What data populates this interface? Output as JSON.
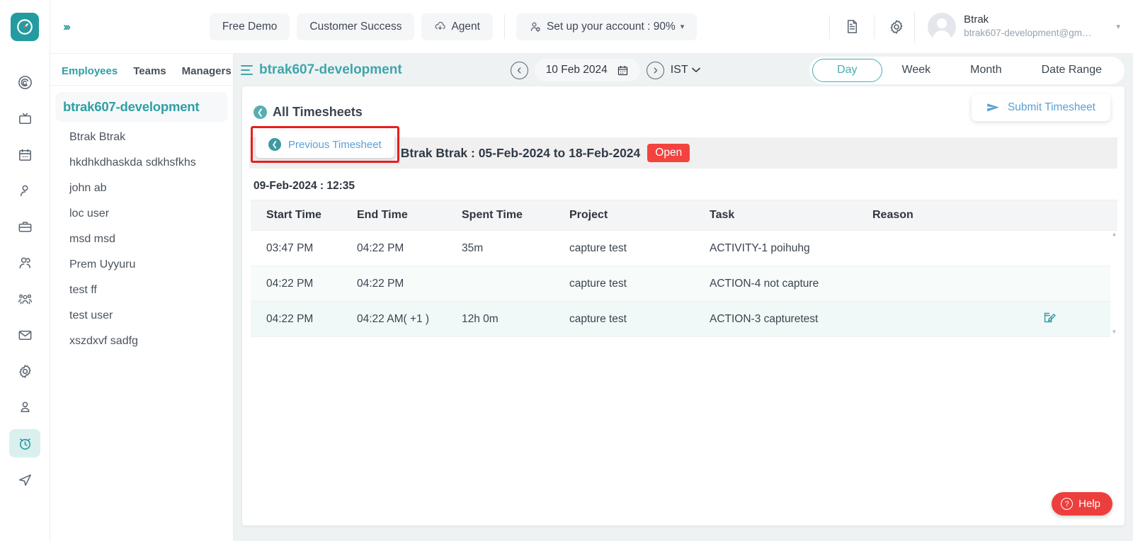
{
  "brand": {
    "accent": "#2fa0a5",
    "danger": "#f3433f",
    "link": "#5d9fd1",
    "highlight": "#e81f1f"
  },
  "topbar": {
    "logo_icon": "clock-logo-icon",
    "expand_icon": "double-chevron-right-icon",
    "buttons": [
      {
        "label": "Free Demo",
        "icon": ""
      },
      {
        "label": "Customer Success",
        "icon": ""
      },
      {
        "label": "Agent",
        "icon": "cloud-download-icon"
      },
      {
        "label": "Set up your account : 90%",
        "icon": "account-setup-icon",
        "caret": "▾"
      }
    ],
    "doc_icon": "document-icon",
    "settings_icon": "gear-icon",
    "user": {
      "name": "Btrak",
      "email": "btrak607-development@gm…",
      "avatar_icon": "avatar-icon",
      "caret": "▾"
    }
  },
  "rail": {
    "items": [
      {
        "name": "dashboard-spiral-icon",
        "active": false
      },
      {
        "name": "tv-screen-icon",
        "active": false
      },
      {
        "name": "calendar-icon",
        "active": false
      },
      {
        "name": "user-icon",
        "active": false
      },
      {
        "name": "briefcase-icon",
        "active": false
      },
      {
        "name": "users-pair-icon",
        "active": false
      },
      {
        "name": "org-team-icon",
        "active": false
      },
      {
        "name": "mail-icon",
        "active": false
      },
      {
        "name": "gear-icon",
        "active": false
      },
      {
        "name": "person-badge-icon",
        "active": false
      },
      {
        "name": "alarm-clock-icon",
        "active": true
      },
      {
        "name": "send-navigate-icon",
        "active": false
      }
    ]
  },
  "employees_panel": {
    "tabs": [
      {
        "label": "Employees",
        "active": true
      },
      {
        "label": "Teams",
        "active": false
      },
      {
        "label": "Managers",
        "active": false
      }
    ],
    "group_header": "btrak607-development",
    "items": [
      "Btrak Btrak",
      "hkdhkdhaskda sdkhsfkhs",
      "john ab",
      "loc user",
      "msd msd",
      "Prem Uyyuru",
      "test ff",
      "test user",
      "xszdxvf sadfg"
    ]
  },
  "main_header": {
    "menu_icon": "hamburger-icon",
    "title": "btrak607-development",
    "prev_day_icon": "chevron-left-circle-icon",
    "date": "10 Feb 2024",
    "calendar_icon": "calendar-icon",
    "next_day_icon": "chevron-right-circle-icon",
    "timezone": "IST",
    "timezone_caret": "⌄",
    "view_tabs": [
      {
        "label": "Day",
        "active": true
      },
      {
        "label": "Week",
        "active": false
      },
      {
        "label": "Month",
        "active": false
      },
      {
        "label": "Date Range",
        "active": false
      }
    ]
  },
  "card": {
    "back_icon": "back-arrow-circle-icon",
    "page_title": "All Timesheets",
    "submit_button": {
      "label": "Submit Timesheet",
      "icon": "send-plane-icon"
    },
    "previous_button": {
      "label": "Previous Timesheet",
      "icon": "back-arrow-circle-icon"
    },
    "period_title": "Btrak Btrak : 05-Feb-2024 to 18-Feb-2024",
    "status_badge": "Open",
    "day_label": "09-Feb-2024 : 12:35",
    "table": {
      "columns": [
        "Start Time",
        "End Time",
        "Spent Time",
        "Project",
        "Task",
        "Reason"
      ],
      "rows": [
        {
          "start_time": "03:47 PM",
          "end_time": "04:22 PM",
          "spent_time": "35m",
          "project": "capture test",
          "task": "ACTIVITY-1 poihuhg",
          "reason": "",
          "edit_icon": ""
        },
        {
          "start_time": "04:22 PM",
          "end_time": "04:22 PM",
          "spent_time": "",
          "project": "capture test",
          "task": "ACTION-4 not capture",
          "reason": "",
          "edit_icon": ""
        },
        {
          "start_time": "04:22 PM",
          "end_time": "04:22 AM( +1 )",
          "spent_time": "12h 0m",
          "project": "capture test",
          "task": "ACTION-3 capturetest",
          "reason": "",
          "edit_icon": "edit-pencil-icon"
        }
      ]
    }
  },
  "help": {
    "label": "Help",
    "icon": "question-circle-icon"
  }
}
